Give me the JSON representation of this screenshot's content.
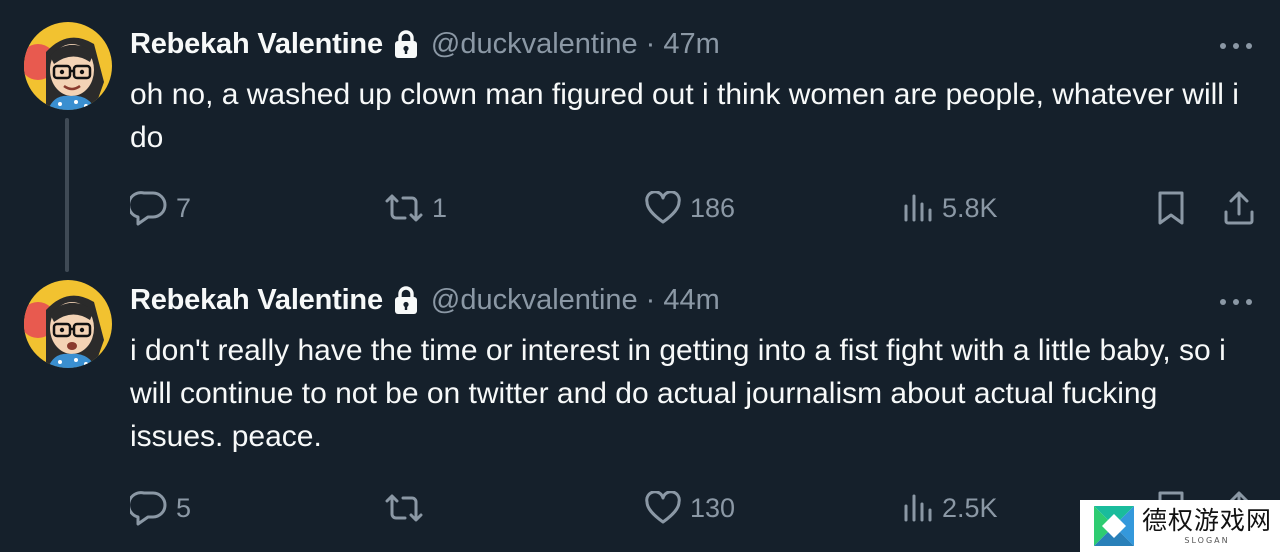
{
  "tweets": [
    {
      "name": "Rebekah Valentine",
      "handle": "@duckvalentine",
      "separator": "·",
      "time": "47m",
      "text": "oh no, a washed up clown man figured out i think women are people, whatever will i do",
      "replies": "7",
      "retweets": "1",
      "likes": "186",
      "views": "5.8K"
    },
    {
      "name": "Rebekah Valentine",
      "handle": "@duckvalentine",
      "separator": "·",
      "time": "44m",
      "text": "i don't really have the time or interest in getting into a fist fight with a little baby, so i will continue to not be on twitter and do actual journalism about actual fucking issues. peace.",
      "replies": "5",
      "retweets": "",
      "likes": "130",
      "views": "2.5K"
    }
  ],
  "icons": {
    "lock": "lock-icon",
    "more": "more-horizontal-icon",
    "reply": "reply-icon",
    "retweet": "retweet-icon",
    "like": "heart-icon",
    "views": "views-icon",
    "bookmark": "bookmark-icon",
    "share": "share-icon"
  },
  "colors": {
    "background": "#15202b",
    "text_primary": "#f7f9f9",
    "text_secondary": "#8b98a5",
    "thread_line": "#3f4a55"
  },
  "watermark": {
    "title": "德权游戏网",
    "slogan": "SLOGAN"
  }
}
